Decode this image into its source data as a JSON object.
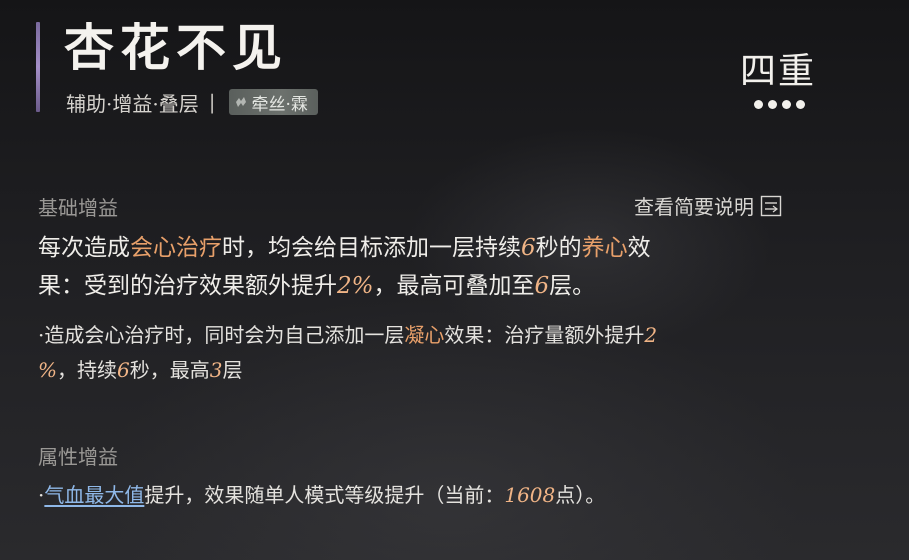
{
  "header": {
    "title": "杏花不见",
    "tags": "辅助·增益·叠层",
    "separator": "|",
    "school_badge": "牵丝·霖",
    "rank": "四重",
    "rank_dots": 4,
    "accent_color": "#a48fc7"
  },
  "base_buff": {
    "label": "基础增益",
    "view_brief": "查看简要说明",
    "line1": {
      "a": "每次造成",
      "b": "会心治疗",
      "c": "时，均会给目标添加一层持续",
      "d": "6",
      "e": "秒的",
      "f": "养心",
      "g": "效"
    },
    "line2": {
      "a": "果：受到的治疗效果额外提升",
      "b": "2%",
      "c": "，最高可叠加至",
      "d": "6",
      "e": "层。"
    },
    "line3": {
      "a": "·造成会心治疗时，同时会为自己添加一层",
      "b": "凝心",
      "c": "效果：治疗量额外提升",
      "d": "2"
    },
    "line4": {
      "a": "%",
      "b": "，持续",
      "c": "6",
      "d": "秒，最高",
      "e": "3",
      "f": "层"
    }
  },
  "attr_buff": {
    "label": "属性增益",
    "line": {
      "a": "·",
      "b": "气血最大值",
      "c": "提升，效果随单人模式等级提升（当前：",
      "d": "1608",
      "e": "点）。"
    }
  },
  "colors": {
    "highlight_orange": "#e8a06a",
    "highlight_number": "#f0b486",
    "link_blue": "#8fb8e8"
  }
}
